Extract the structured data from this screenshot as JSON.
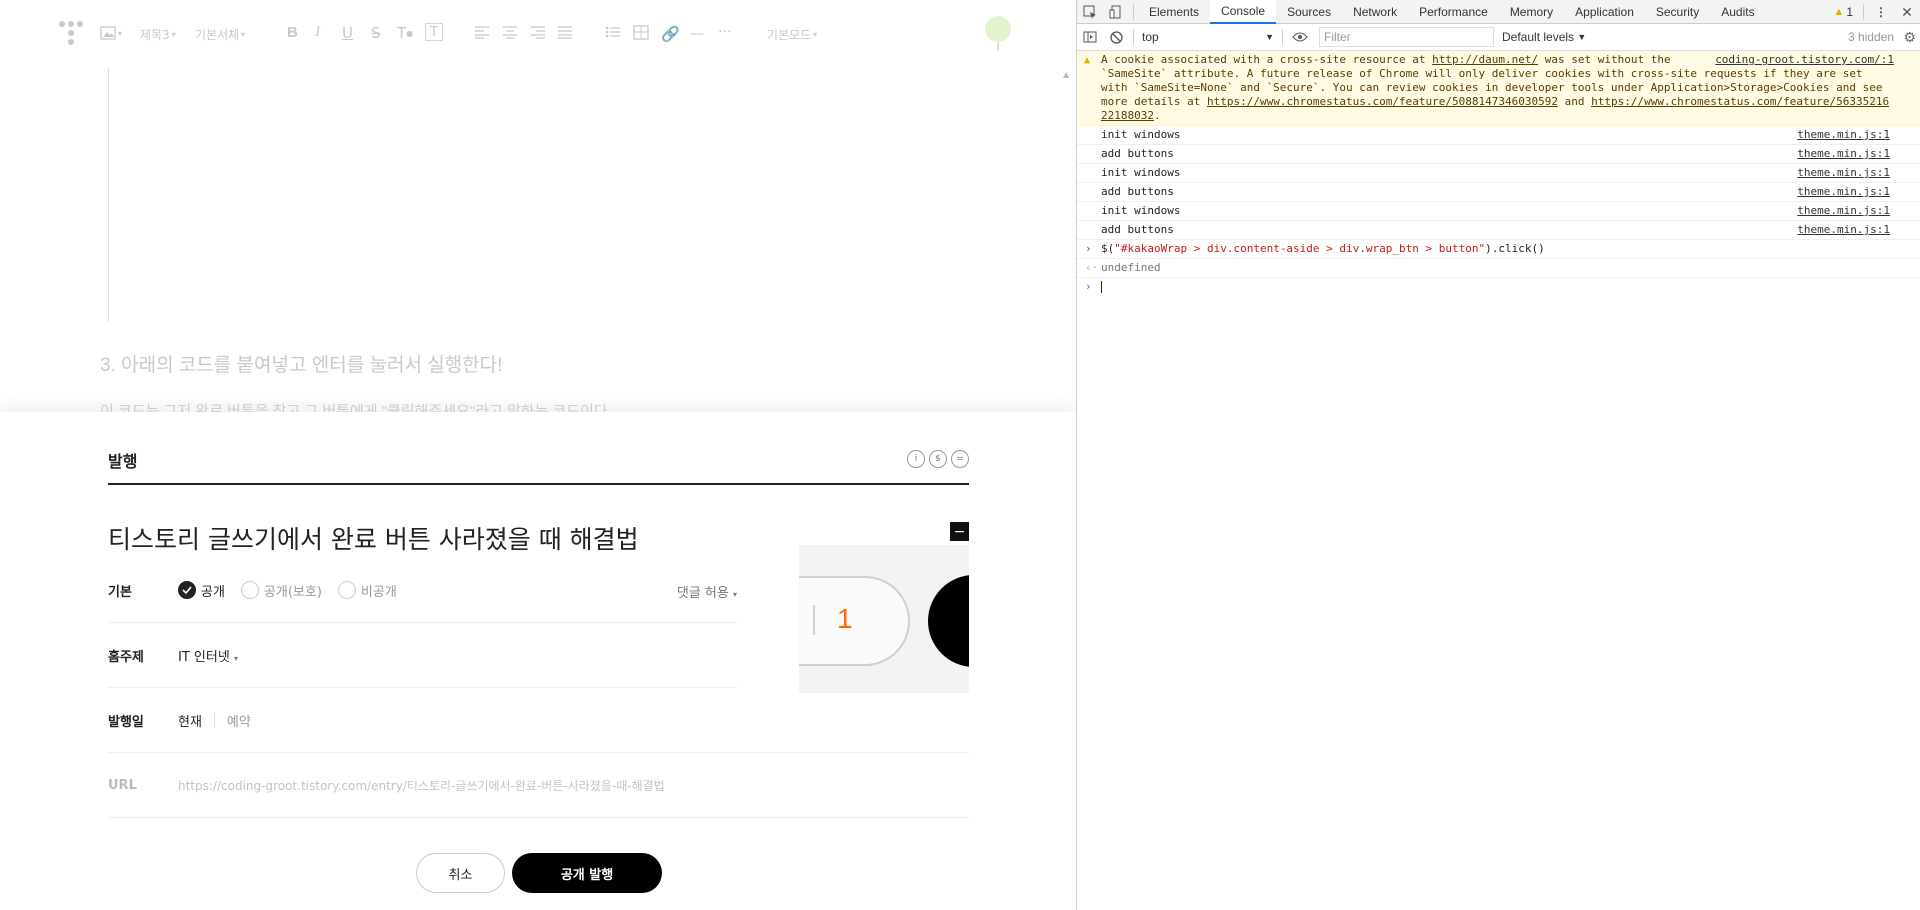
{
  "editor": {
    "toolbar": {
      "heading_select": "제목3",
      "font_select": "기본서체",
      "mode_select": "기본모드"
    },
    "section_heading": "3. 아래의 코드를 붙여넣고 엔터를 눌러서 실행한다!",
    "section_paragraph": "이 코드는 그저 완료 버튼을 찾고 그 버튼에게 \"클릭해주세요\"라고 말하는 코드이다"
  },
  "publish": {
    "header_title": "발행",
    "post_title": "티스토리 글쓰기에서 완료 버튼 사라졌을 때 해결법",
    "basic_label": "기본",
    "visibility_options": [
      {
        "label": "공개",
        "checked": true
      },
      {
        "label": "공개(보호)",
        "checked": false
      },
      {
        "label": "비공개",
        "checked": false
      }
    ],
    "comment_allow": "댓글 허용",
    "home_topic_label": "홈주제",
    "home_topic_value": "IT 인터넷",
    "date_label": "발행일",
    "date_now": "현재",
    "date_reserve": "예약",
    "url_label": "URL",
    "url_value": "https://coding-groot.tistory.com/entry/티스토리-글쓰기에서-완료-버튼-사라졌을-때-해결법",
    "thumb_number": "1",
    "cancel_button": "취소",
    "publish_button": "공개 발행"
  },
  "devtools": {
    "tabs": [
      "Elements",
      "Console",
      "Sources",
      "Network",
      "Performance",
      "Memory",
      "Application",
      "Security",
      "Audits"
    ],
    "active_tab": "Console",
    "warning_count": "1",
    "context": "top",
    "filter_placeholder": "Filter",
    "levels": "Default levels",
    "hidden": "3 hidden",
    "warning_message": {
      "text_1": "A cookie associated with a cross-site resource at ",
      "link_1": "http://daum.net/",
      "text_2": " was set without the `SameSite` attribute. A future release of Chrome will only deliver cookies with cross-site requests if they are set with `SameSite=None` and `Secure`. You can review cookies in developer tools under Application>Storage>Cookies and see more details at ",
      "link_2": "https://www.chromestatus.com/feature/5088147346030592",
      "text_3": " and ",
      "link_3": "https://www.chromestatus.com/feature/5633521622188032",
      "text_4": ".",
      "source": "coding-groot.tistory.com/:1"
    },
    "log_messages": [
      {
        "text": "init windows",
        "source": "theme.min.js:1"
      },
      {
        "text": "add buttons",
        "source": "theme.min.js:1"
      },
      {
        "text": "init windows",
        "source": "theme.min.js:1"
      },
      {
        "text": "add buttons",
        "source": "theme.min.js:1"
      },
      {
        "text": "init windows",
        "source": "theme.min.js:1"
      },
      {
        "text": "add buttons",
        "source": "theme.min.js:1"
      }
    ],
    "command": {
      "prefix": "$(",
      "selector": "\"#kakaoWrap > div.content-aside > div.wrap_btn > button\"",
      "suffix": ").click()"
    },
    "result": "undefined"
  },
  "colors": {
    "accent_blue": "#1a73e8",
    "warning_bg": "#fffbe5",
    "warning_icon": "#f0a500",
    "thumb_number": "#ff6a00"
  }
}
